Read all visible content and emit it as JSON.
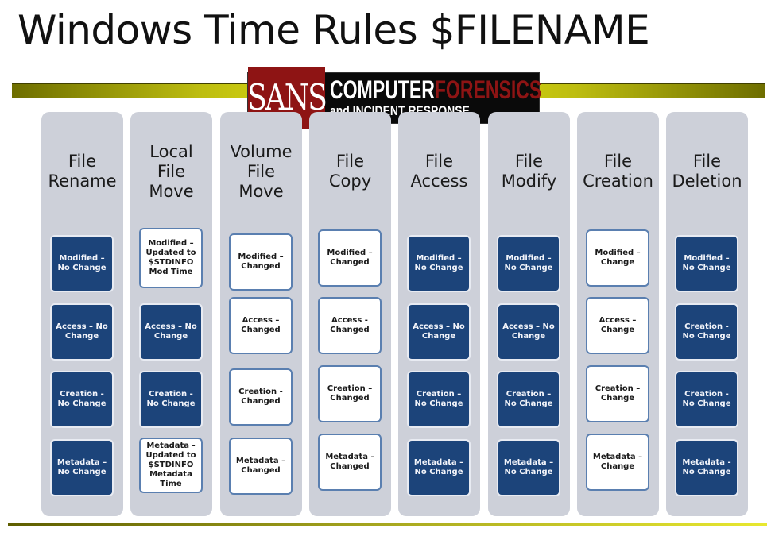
{
  "title": "Windows Time Rules $FILENAME",
  "logo": {
    "brand": "SANS",
    "line1_a": "COMPUTER",
    "line1_b": "FORENSICS",
    "line2": "and INCIDENT RESPONSE"
  },
  "colors": {
    "no_change_box": "#1c447a",
    "changed_box": "#ffffff",
    "changed_border": "#5a7fb0",
    "column_bg": "#cdd0d9",
    "accent_bar": "#d4d410",
    "logo_red": "#8e1414"
  },
  "columns": [
    {
      "header": "File\nRename",
      "boxes": [
        {
          "text": "Modified –\nNo Change",
          "state": "no_change"
        },
        {
          "text": "Access – No\nChange",
          "state": "no_change"
        },
        {
          "text": "Creation -\nNo Change",
          "state": "no_change"
        },
        {
          "text": "Metadata –\nNo Change",
          "state": "no_change"
        }
      ]
    },
    {
      "header": "Local\nFile\nMove",
      "boxes": [
        {
          "text": "Modified –\nUpdated to\n$STDINFO\nMod Time",
          "state": "changed"
        },
        {
          "text": "Access – No\nChange",
          "state": "no_change"
        },
        {
          "text": "Creation -\nNo Change",
          "state": "no_change"
        },
        {
          "text": "Metadata -\nUpdated to\n$STDINFO\nMetadata\nTime",
          "state": "changed"
        }
      ]
    },
    {
      "header": "Volume\nFile\nMove",
      "boxes": [
        {
          "text": "Modified –\nChanged",
          "state": "changed"
        },
        {
          "text": "Access –\nChanged",
          "state": "changed"
        },
        {
          "text": "Creation -\nChanged",
          "state": "changed"
        },
        {
          "text": "Metadata –\nChanged",
          "state": "changed"
        }
      ]
    },
    {
      "header": "File\nCopy",
      "boxes": [
        {
          "text": "Modified –\nChanged",
          "state": "changed"
        },
        {
          "text": "Access -\nChanged",
          "state": "changed"
        },
        {
          "text": "Creation –\nChanged",
          "state": "changed"
        },
        {
          "text": "Metadata -\nChanged",
          "state": "changed"
        }
      ]
    },
    {
      "header": "File\nAccess",
      "boxes": [
        {
          "text": "Modified –\nNo Change",
          "state": "no_change"
        },
        {
          "text": "Access – No\nChange",
          "state": "no_change"
        },
        {
          "text": "Creation –\nNo Change",
          "state": "no_change"
        },
        {
          "text": "Metadata –\nNo Change",
          "state": "no_change"
        }
      ]
    },
    {
      "header": "File\nModify",
      "boxes": [
        {
          "text": "Modified –\nNo Change",
          "state": "no_change"
        },
        {
          "text": "Access – No\nChange",
          "state": "no_change"
        },
        {
          "text": "Creation –\nNo Change",
          "state": "no_change"
        },
        {
          "text": "Metadata –\nNo Change",
          "state": "no_change"
        }
      ]
    },
    {
      "header": "File\nCreation",
      "boxes": [
        {
          "text": "Modified –\nChange",
          "state": "changed"
        },
        {
          "text": "Access –\nChange",
          "state": "changed"
        },
        {
          "text": "Creation –\nChange",
          "state": "changed"
        },
        {
          "text": "Metadata –\nChange",
          "state": "changed"
        }
      ]
    },
    {
      "header": "File\nDeletion",
      "boxes": [
        {
          "text": "Modified –\nNo Change",
          "state": "no_change"
        },
        {
          "text": "Creation -\nNo Change",
          "state": "no_change"
        },
        {
          "text": "Creation -\nNo Change",
          "state": "no_change"
        },
        {
          "text": "Metadata -\nNo Change",
          "state": "no_change"
        }
      ]
    }
  ]
}
